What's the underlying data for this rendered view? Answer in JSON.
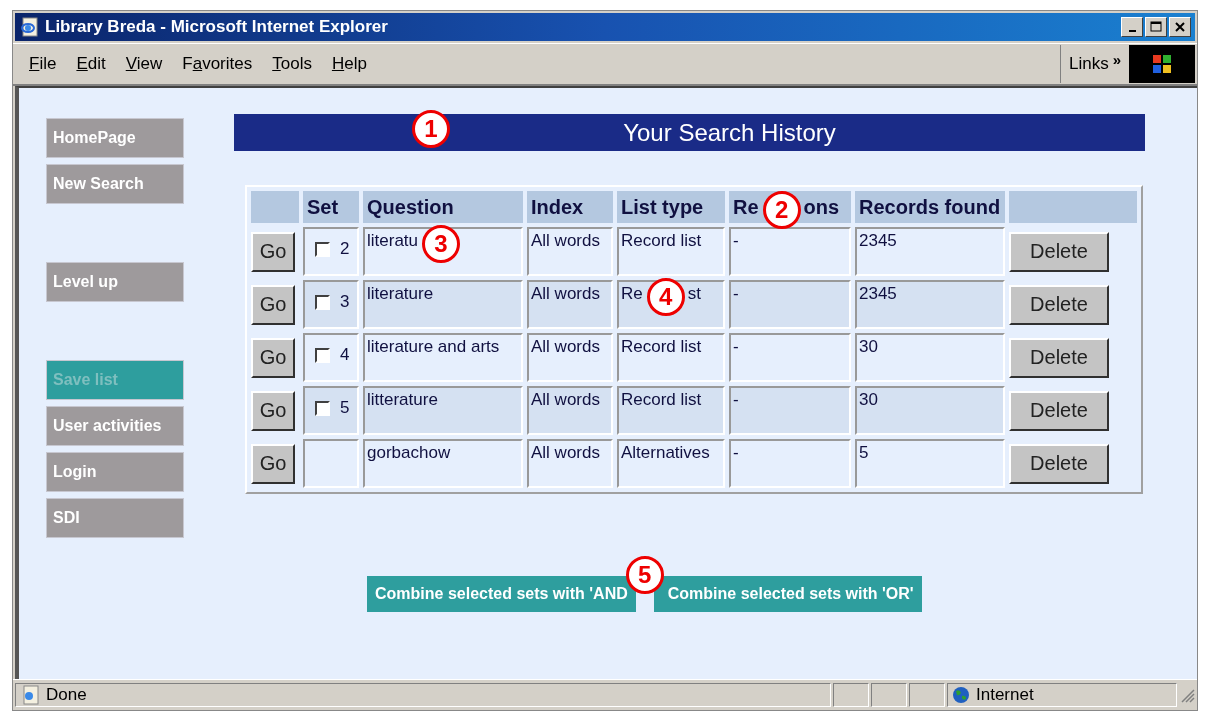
{
  "window": {
    "title": "Library Breda - Microsoft Internet Explorer"
  },
  "menu": [
    {
      "key": "F",
      "rest": "ile"
    },
    {
      "key": "E",
      "rest": "dit"
    },
    {
      "key": "V",
      "rest": "iew"
    },
    {
      "lead": "F",
      "key": "a",
      "rest": "vorites"
    },
    {
      "key": "T",
      "rest": "ools"
    },
    {
      "key": "H",
      "rest": "elp"
    }
  ],
  "links": {
    "label": "Links",
    "chevron": "»"
  },
  "sidebar": {
    "groups": [
      [
        {
          "label": "HomePage",
          "disabled": false
        },
        {
          "label": "New Search",
          "disabled": false
        }
      ],
      [
        {
          "label": "Level up",
          "disabled": false
        }
      ],
      [
        {
          "label": "Save list",
          "disabled": true
        },
        {
          "label": "User activities",
          "disabled": false
        },
        {
          "label": "Login",
          "disabled": false
        },
        {
          "label": "SDI",
          "disabled": false
        }
      ]
    ]
  },
  "banner": {
    "title": "Your Search History",
    "annotation": "1"
  },
  "table": {
    "columns": [
      {
        "kind": "blank"
      },
      {
        "kind": "text",
        "label": "Set"
      },
      {
        "kind": "text",
        "label": "Question"
      },
      {
        "kind": "text",
        "label": "Index"
      },
      {
        "kind": "text",
        "label": "List type"
      },
      {
        "kind": "text",
        "label": {
          "text": "Re",
          "annotation": "2",
          "after": "ons"
        }
      },
      {
        "kind": "text",
        "label": "Records found"
      },
      {
        "kind": "blank"
      }
    ],
    "rows": [
      {
        "go": "Go",
        "set": "2",
        "checked": false,
        "question": {
          "text": "literatu",
          "annotation": "3"
        },
        "index": "All words",
        "list_type": "Record list",
        "relations": "-",
        "records": "2345",
        "delete": "Delete"
      },
      {
        "go": "Go",
        "set": "3",
        "checked": false,
        "question": "literature",
        "index": "All words",
        "list_type": {
          "text": "Re",
          "annotation": "4",
          "after": "st"
        },
        "relations": "-",
        "records": "2345",
        "delete": "Delete"
      },
      {
        "go": "Go",
        "set": "4",
        "checked": false,
        "question": "literature and arts",
        "index": "All words",
        "list_type": "Record list",
        "relations": "-",
        "records": "30",
        "delete": "Delete"
      },
      {
        "go": "Go",
        "set": "5",
        "checked": false,
        "question": "litterature",
        "index": "All words",
        "list_type": "Record list",
        "relations": "-",
        "records": "30",
        "delete": "Delete"
      },
      {
        "go": "Go",
        "question": "gorbachow",
        "index": "All words",
        "list_type": "Alternatives",
        "relations": "-",
        "records": "5",
        "delete": "Delete"
      }
    ]
  },
  "combine": {
    "buttons": [
      "Combine selected sets with 'AND",
      "Combine selected sets with 'OR'"
    ],
    "annotation": "5"
  },
  "status_bar": {
    "text": "Done",
    "zone": "Internet"
  }
}
